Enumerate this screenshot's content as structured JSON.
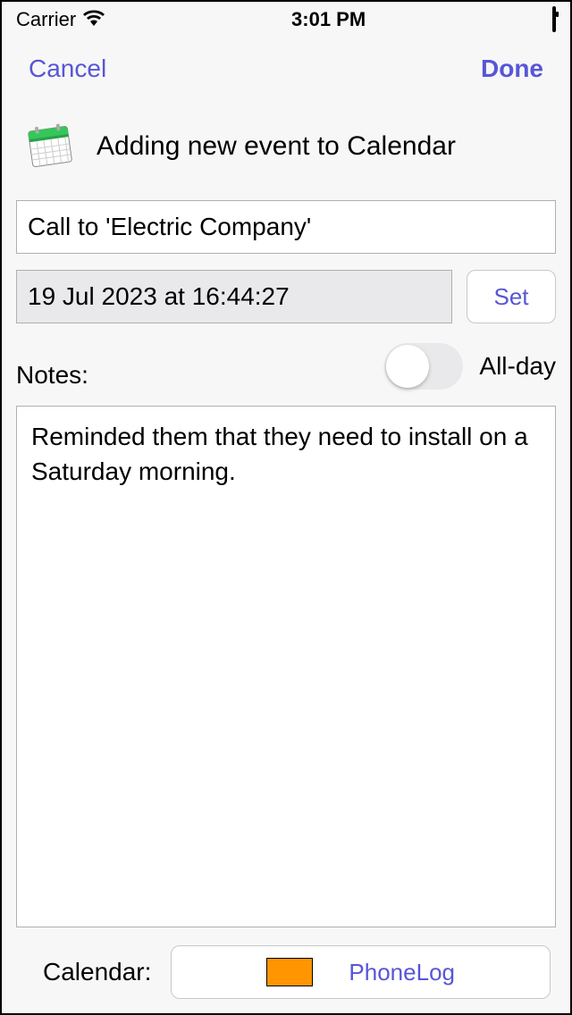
{
  "status": {
    "carrier": "Carrier",
    "time": "3:01 PM"
  },
  "nav": {
    "cancel": "Cancel",
    "done": "Done"
  },
  "heading": "Adding new event to Calendar",
  "event": {
    "title": "Call to 'Electric Company'",
    "date_display": "19 Jul 2023 at 16:44:27",
    "set_label": "Set",
    "all_day_label": "All-day",
    "all_day": false,
    "notes_label": "Notes:",
    "notes": "Reminded them that they need to install on a Saturday morning."
  },
  "calendar": {
    "label": "Calendar:",
    "color": "#ff9500",
    "name": "PhoneLog"
  }
}
